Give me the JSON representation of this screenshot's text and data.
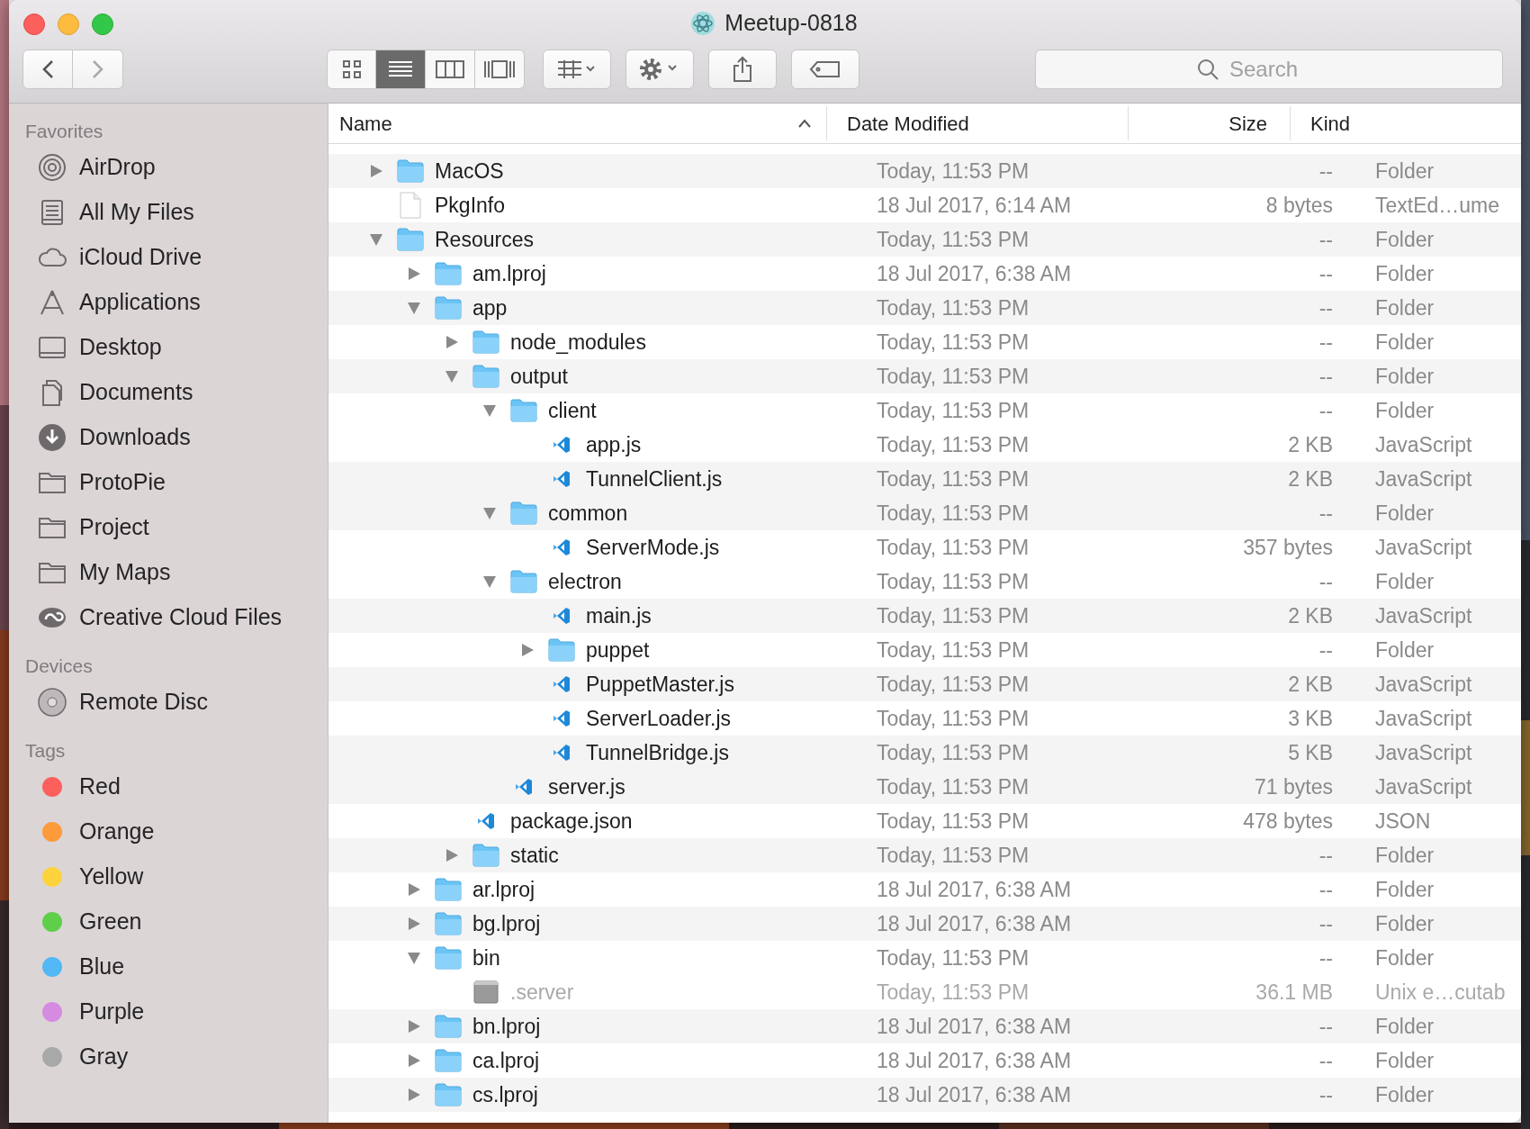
{
  "window": {
    "title": "Meetup-0818"
  },
  "toolbar": {
    "view_modes": [
      {
        "kind": "icons",
        "selected": false
      },
      {
        "kind": "list",
        "selected": true
      },
      {
        "kind": "columns",
        "selected": false
      },
      {
        "kind": "gallery",
        "selected": false
      }
    ],
    "search": {
      "placeholder": "Search"
    }
  },
  "sidebar": [
    {
      "heading": "Favorites",
      "items": [
        {
          "label": "AirDrop",
          "kind": "airdrop"
        },
        {
          "label": "All My Files",
          "kind": "files"
        },
        {
          "label": "iCloud Drive",
          "kind": "cloud"
        },
        {
          "label": "Applications",
          "kind": "apps"
        },
        {
          "label": "Desktop",
          "kind": "desktop"
        },
        {
          "label": "Documents",
          "kind": "documents"
        },
        {
          "label": "Downloads",
          "kind": "downloads"
        },
        {
          "label": "ProtoPie",
          "kind": "folder"
        },
        {
          "label": "Project",
          "kind": "folder"
        },
        {
          "label": "My Maps",
          "kind": "folder"
        },
        {
          "label": "Creative Cloud Files",
          "kind": "creative"
        }
      ]
    },
    {
      "heading": "Devices",
      "items": [
        {
          "label": "Remote Disc",
          "kind": "disc"
        }
      ]
    },
    {
      "heading": "Tags",
      "items": [
        {
          "label": "Red",
          "kind": "tag",
          "color": "#fc605c"
        },
        {
          "label": "Orange",
          "kind": "tag",
          "color": "#fd9a3a"
        },
        {
          "label": "Yellow",
          "kind": "tag",
          "color": "#fdd33d"
        },
        {
          "label": "Green",
          "kind": "tag",
          "color": "#5fcf4a"
        },
        {
          "label": "Blue",
          "kind": "tag",
          "color": "#52b8f6"
        },
        {
          "label": "Purple",
          "kind": "tag",
          "color": "#d58be0"
        },
        {
          "label": "Gray",
          "kind": "tag",
          "color": "#a8a8a8"
        }
      ]
    }
  ],
  "columns": [
    {
      "label": "Name",
      "sorted": true
    },
    {
      "label": "Date Modified",
      "sorted": false
    },
    {
      "label": "Size",
      "sorted": false
    },
    {
      "label": "Kind",
      "sorted": false
    }
  ],
  "rows": [
    {
      "kind": "folder",
      "name": "MacOS",
      "date": "Today, 11:53 PM",
      "size": "--",
      "type": "Folder",
      "expanded": false,
      "dimmed": false
    },
    {
      "kind": "document",
      "name": "PkgInfo",
      "date": "18 Jul 2017, 6:14 AM",
      "size": "8 bytes",
      "type": "TextEd…ume",
      "dimmed": false
    },
    {
      "kind": "folder",
      "name": "Resources",
      "date": "Today, 11:53 PM",
      "size": "--",
      "type": "Folder",
      "expanded": true,
      "dimmed": false,
      "children": [
        {
          "kind": "folder",
          "name": "am.lproj",
          "date": "18 Jul 2017, 6:38 AM",
          "size": "--",
          "type": "Folder",
          "expanded": false,
          "dimmed": false
        },
        {
          "kind": "folder",
          "name": "app",
          "date": "Today, 11:53 PM",
          "size": "--",
          "type": "Folder",
          "expanded": true,
          "dimmed": false,
          "children": [
            {
              "kind": "folder",
              "name": "node_modules",
              "date": "Today, 11:53 PM",
              "size": "--",
              "type": "Folder",
              "expanded": false,
              "dimmed": false
            },
            {
              "kind": "folder",
              "name": "output",
              "date": "Today, 11:53 PM",
              "size": "--",
              "type": "Folder",
              "expanded": true,
              "dimmed": false,
              "children": [
                {
                  "kind": "folder",
                  "name": "client",
                  "date": "Today, 11:53 PM",
                  "size": "--",
                  "type": "Folder",
                  "expanded": true,
                  "dimmed": false,
                  "children": [
                    {
                      "kind": "script",
                      "name": "app.js",
                      "date": "Today, 11:53 PM",
                      "size": "2 KB",
                      "type": "JavaScript",
                      "dimmed": false
                    },
                    {
                      "kind": "script",
                      "name": "TunnelClient.js",
                      "date": "Today, 11:53 PM",
                      "size": "2 KB",
                      "type": "JavaScript",
                      "dimmed": false
                    }
                  ]
                },
                {
                  "kind": "folder",
                  "name": "common",
                  "date": "Today, 11:53 PM",
                  "size": "--",
                  "type": "Folder",
                  "expanded": true,
                  "dimmed": false,
                  "children": [
                    {
                      "kind": "script",
                      "name": "ServerMode.js",
                      "date": "Today, 11:53 PM",
                      "size": "357 bytes",
                      "type": "JavaScript",
                      "dimmed": false
                    }
                  ]
                },
                {
                  "kind": "folder",
                  "name": "electron",
                  "date": "Today, 11:53 PM",
                  "size": "--",
                  "type": "Folder",
                  "expanded": true,
                  "dimmed": false,
                  "children": [
                    {
                      "kind": "script",
                      "name": "main.js",
                      "date": "Today, 11:53 PM",
                      "size": "2 KB",
                      "type": "JavaScript",
                      "dimmed": false
                    },
                    {
                      "kind": "folder",
                      "name": "puppet",
                      "date": "Today, 11:53 PM",
                      "size": "--",
                      "type": "Folder",
                      "expanded": false,
                      "dimmed": false
                    },
                    {
                      "kind": "script",
                      "name": "PuppetMaster.js",
                      "date": "Today, 11:53 PM",
                      "size": "2 KB",
                      "type": "JavaScript",
                      "dimmed": false
                    },
                    {
                      "kind": "script",
                      "name": "ServerLoader.js",
                      "date": "Today, 11:53 PM",
                      "size": "3 KB",
                      "type": "JavaScript",
                      "dimmed": false
                    },
                    {
                      "kind": "script",
                      "name": "TunnelBridge.js",
                      "date": "Today, 11:53 PM",
                      "size": "5 KB",
                      "type": "JavaScript",
                      "dimmed": false
                    }
                  ]
                },
                {
                  "kind": "script",
                  "name": "server.js",
                  "date": "Today, 11:53 PM",
                  "size": "71 bytes",
                  "type": "JavaScript",
                  "dimmed": false
                }
              ]
            },
            {
              "kind": "script",
              "name": "package.json",
              "date": "Today, 11:53 PM",
              "size": "478 bytes",
              "type": "JSON",
              "dimmed": false
            },
            {
              "kind": "folder",
              "name": "static",
              "date": "Today, 11:53 PM",
              "size": "--",
              "type": "Folder",
              "expanded": false,
              "dimmed": false
            }
          ]
        },
        {
          "kind": "folder",
          "name": "ar.lproj",
          "date": "18 Jul 2017, 6:38 AM",
          "size": "--",
          "type": "Folder",
          "expanded": false,
          "dimmed": false
        },
        {
          "kind": "folder",
          "name": "bg.lproj",
          "date": "18 Jul 2017, 6:38 AM",
          "size": "--",
          "type": "Folder",
          "expanded": false,
          "dimmed": false
        },
        {
          "kind": "folder",
          "name": "bin",
          "date": "Today, 11:53 PM",
          "size": "--",
          "type": "Folder",
          "expanded": true,
          "dimmed": false,
          "children": [
            {
              "kind": "executable",
              "name": ".server",
              "date": "Today, 11:53 PM",
              "size": "36.1 MB",
              "type": "Unix e…cutab",
              "dimmed": true
            }
          ]
        },
        {
          "kind": "folder",
          "name": "bn.lproj",
          "date": "18 Jul 2017, 6:38 AM",
          "size": "--",
          "type": "Folder",
          "expanded": false,
          "dimmed": false
        },
        {
          "kind": "folder",
          "name": "ca.lproj",
          "date": "18 Jul 2017, 6:38 AM",
          "size": "--",
          "type": "Folder",
          "expanded": false,
          "dimmed": false
        },
        {
          "kind": "folder",
          "name": "cs.lproj",
          "date": "18 Jul 2017, 6:38 AM",
          "size": "--",
          "type": "Folder",
          "expanded": false,
          "dimmed": false
        }
      ]
    }
  ]
}
